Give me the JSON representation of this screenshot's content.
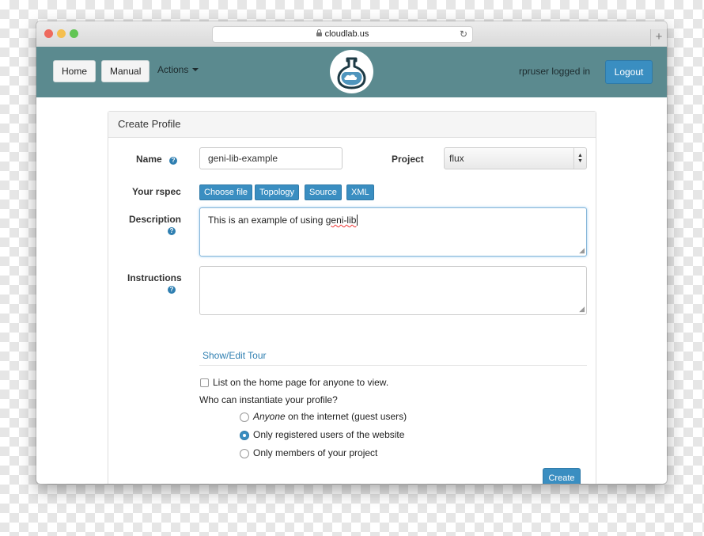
{
  "browser": {
    "url": "cloudlab.us",
    "newtab_label": "+"
  },
  "navbar": {
    "home_label": "Home",
    "manual_label": "Manual",
    "actions_label": "Actions",
    "login_status": "rpruser logged in",
    "logout_label": "Logout"
  },
  "panel": {
    "heading": "Create Profile"
  },
  "form": {
    "name_label": "Name",
    "name_value": "geni-lib-example",
    "project_label": "Project",
    "project_value": "flux",
    "rspec_label": "Your rspec",
    "rspec_buttons": [
      "Choose file",
      "Topology",
      "Source",
      "XML"
    ],
    "description_label": "Description",
    "description_prefix": "This is an example of using ",
    "description_misspelled": "geni-lib",
    "instructions_label": "Instructions",
    "instructions_value": "",
    "tour_link": "Show/Edit Tour",
    "list_checkbox_label": "List on the home page for anyone to view.",
    "list_checked": false,
    "instantiate_question": "Who can instantiate your profile?",
    "options": {
      "anyone_em": "Anyone",
      "anyone_rest": " on the internet (guest users)",
      "registered": "Only registered users of the website",
      "members": "Only members of your project"
    },
    "selected_option": "registered",
    "create_label": "Create"
  },
  "colors": {
    "navbar": "#5b8a8f",
    "accent": "#3a8ec1"
  }
}
